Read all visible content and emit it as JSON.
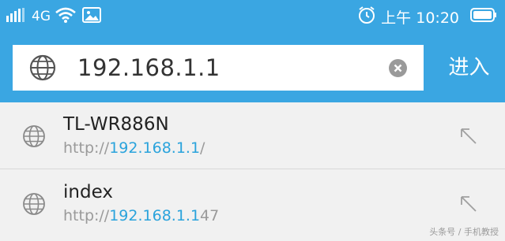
{
  "status_bar": {
    "network": "4G",
    "time_period": "上午",
    "time": "10:20",
    "icons": [
      "signal-icon",
      "wifi-icon",
      "image-icon",
      "alarm-icon",
      "battery-icon"
    ]
  },
  "address_bar": {
    "value": "192.168.1.1",
    "enter_label": "进入"
  },
  "suggestions": [
    {
      "title": "TL-WR886N",
      "url_scheme": "http://",
      "url_host": "192.168.1.1",
      "url_rest": "/"
    },
    {
      "title": "index",
      "url_scheme": "http://",
      "url_host": "192.168.1.1",
      "url_rest": "47"
    }
  ],
  "watermark": "头条号 / 手机教授",
  "colors": {
    "accent": "#3aa6e2",
    "link": "#2aa3dc",
    "background": "#f1f1f1"
  }
}
